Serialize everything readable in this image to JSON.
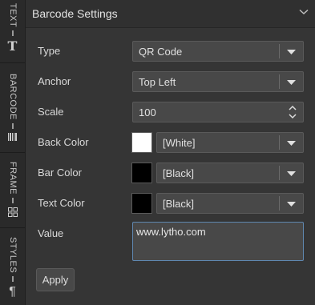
{
  "sidebar": {
    "tabs": [
      {
        "label": "TEXT",
        "icon": "text-t-icon"
      },
      {
        "label": "BARCODE",
        "icon": "barcode-icon"
      },
      {
        "label": "FRAME",
        "icon": "frame-grid-icon"
      },
      {
        "label": "STYLES",
        "icon": "pilcrow-icon"
      }
    ]
  },
  "panel": {
    "title": "Barcode Settings",
    "fields": {
      "type": {
        "label": "Type",
        "value": "QR Code"
      },
      "anchor": {
        "label": "Anchor",
        "value": "Top Left"
      },
      "scale": {
        "label": "Scale",
        "value": "100"
      },
      "back_color": {
        "label": "Back Color",
        "value": "[White]",
        "swatch": "#ffffff"
      },
      "bar_color": {
        "label": "Bar Color",
        "value": "[Black]",
        "swatch": "#000000"
      },
      "text_color": {
        "label": "Text Color",
        "value": "[Black]",
        "swatch": "#000000"
      },
      "value": {
        "label": "Value",
        "value": "www.lytho.com"
      }
    },
    "apply_label": "Apply"
  },
  "colors": {
    "accent_border": "#5f87b0",
    "panel_bg": "#353535"
  }
}
